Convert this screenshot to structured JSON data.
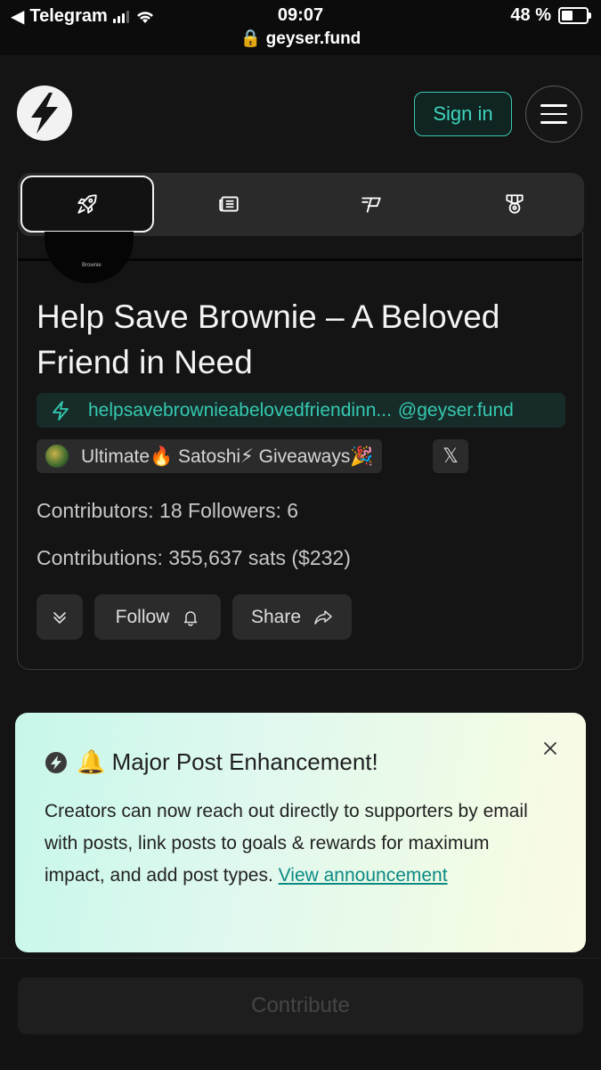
{
  "status_bar": {
    "back_app": "Telegram",
    "time": "09:07",
    "url": "geyser.fund",
    "battery": "48 %"
  },
  "header": {
    "signin_label": "Sign in"
  },
  "nav_tabs": [
    {
      "icon": "rocket-icon",
      "active": true
    },
    {
      "icon": "news-icon",
      "active": false
    },
    {
      "icon": "flag-icon",
      "active": false
    },
    {
      "icon": "medal-icon",
      "active": false
    }
  ],
  "project": {
    "image_caption": "Brownie",
    "title": "Help Save Brownie – A Beloved Friend in Need",
    "lightning_address": "helpsavebrownieabelovedfriendinn...",
    "lightning_domain": "@geyser.fund",
    "owner_name": "Ultimate🔥 Satoshi⚡ Giveaways🎉",
    "social_label": "𝕏",
    "contributors_line": "Contributors: 18  Followers: 6",
    "contributions_line": "Contributions: 355,637 sats ($232)",
    "follow_label": "Follow",
    "share_label": "Share"
  },
  "announcement": {
    "title": "🔔 Major Post Enhancement!",
    "body": "Creators can now reach out directly to supporters by email with posts, link posts to goals & rewards for maximum impact, and add post types. ",
    "link_label": "View announcement"
  },
  "footer": {
    "contribute_label": "Contribute"
  },
  "colors": {
    "accent": "#3dd6bd",
    "background": "#141414"
  }
}
